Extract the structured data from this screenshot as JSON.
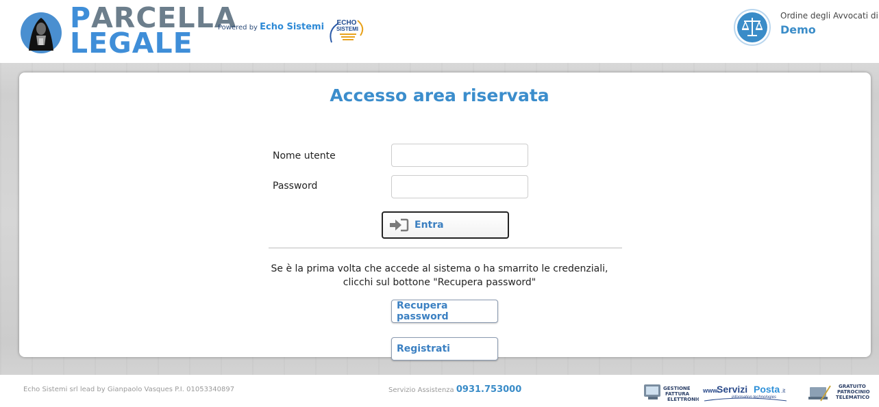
{
  "header": {
    "logo_line1_a": "P",
    "logo_line1_b": "ARCELLA",
    "logo_line2": "LEGALE",
    "powered_prefix": "Powered by",
    "powered_brand": "Echo Sistemi",
    "echo_badge_line1": "ECHO",
    "echo_badge_line2": "SISTEMI",
    "ordine_label": "Ordine degli Avvocati di",
    "ordine_name": "Demo"
  },
  "login": {
    "title": "Accesso area riservata",
    "username_label": "Nome utente",
    "username_value": "",
    "password_label": "Password",
    "password_value": "",
    "submit_label": "Entra",
    "info_line1": "Se è la prima volta che accede al sistema o ha smarrito le credenziali,",
    "info_line2": "clicchi sul bottone \"Recupera password\"",
    "recover_label": "Recupera password",
    "register_label": "Registrati"
  },
  "footer": {
    "company": "Echo Sistemi srl lead by Gianpaolo Vasques P.I. 01053340897",
    "support_prefix": "Servizio Assistenza",
    "support_phone": "0931.753000",
    "logo1_lines": [
      "GESTIONE",
      "FATTURA",
      "ELETTRONICA"
    ],
    "logo2_a": "www.",
    "logo2_b": "Servizi",
    "logo2_c": "Posta",
    "logo2_d": ".it",
    "logo2_sub": "information technologies",
    "logo3_lines": [
      "GRATUITO",
      "PATROCINIO",
      "TELEMATICO"
    ]
  },
  "colors": {
    "accent": "#3b8dcc",
    "logo_gray": "#6c7e8c",
    "text": "#222222"
  }
}
